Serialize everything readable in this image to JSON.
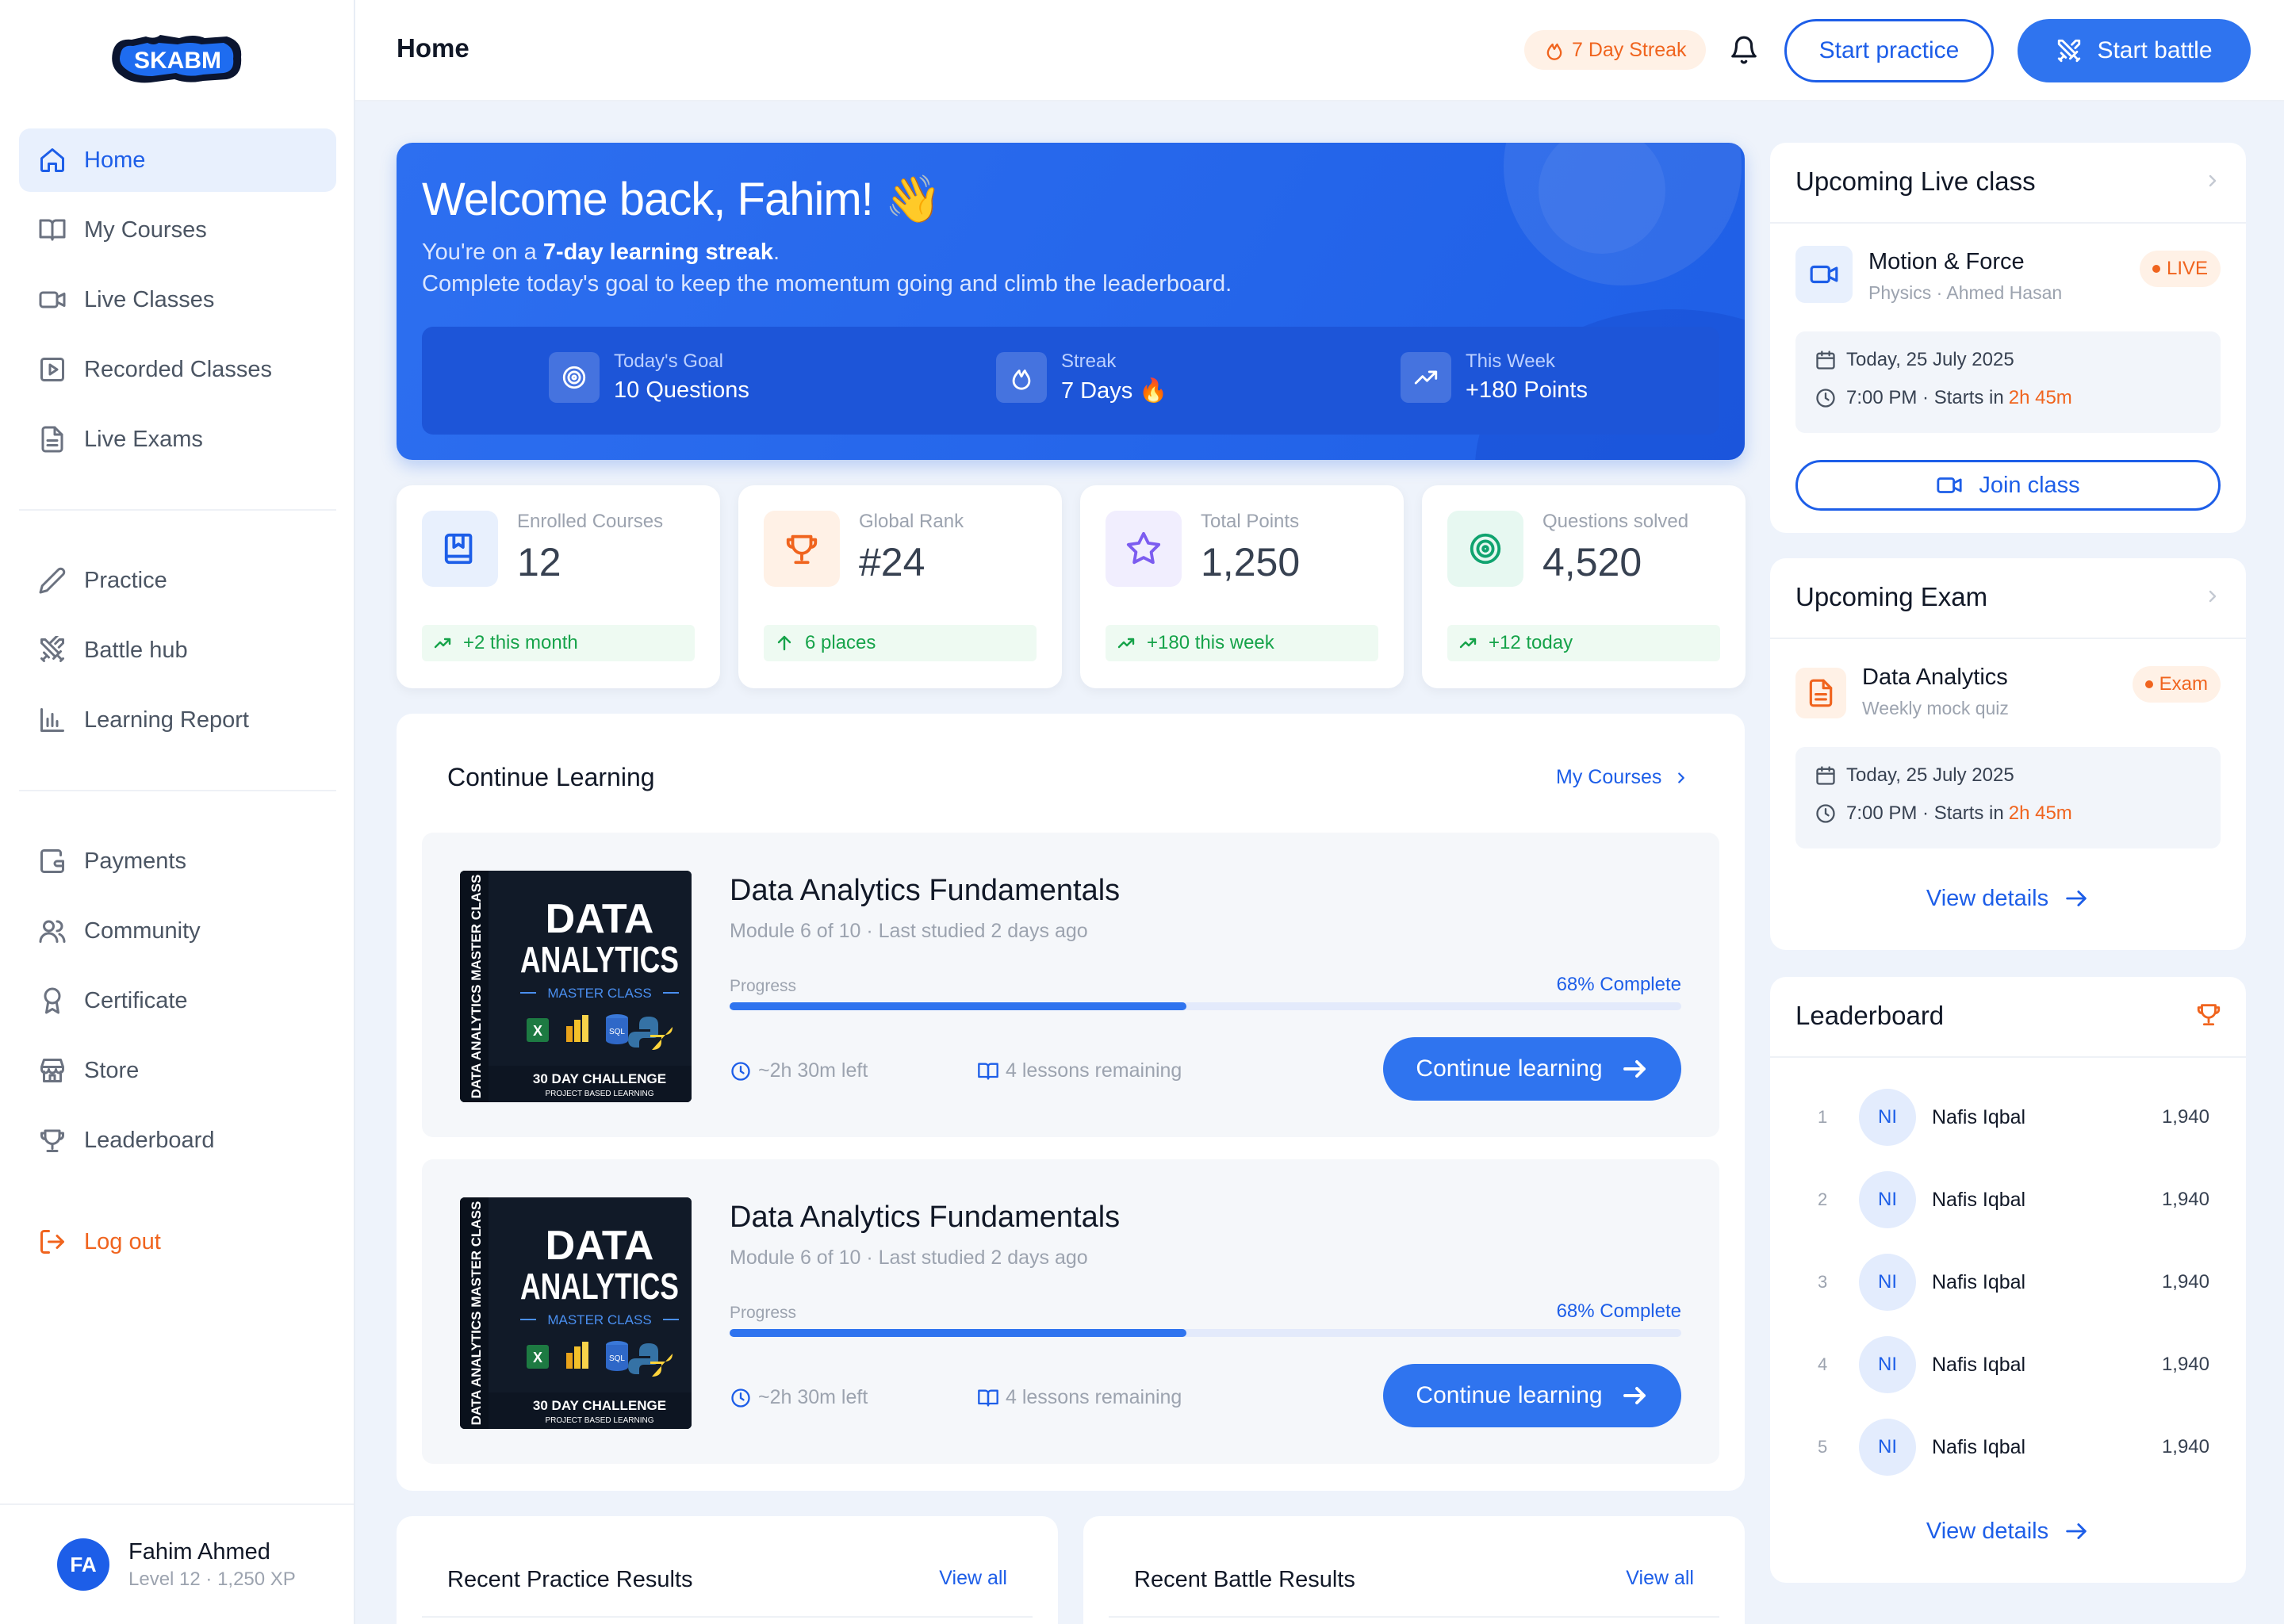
{
  "app": {
    "logo_text": "SKABM"
  },
  "sidebar": {
    "items": [
      {
        "label": "Home",
        "icon": "home-icon"
      },
      {
        "label": "My Courses",
        "icon": "book-open-icon"
      },
      {
        "label": "Live Classes",
        "icon": "video-icon"
      },
      {
        "label": "Recorded Classes",
        "icon": "play-square-icon"
      },
      {
        "label": "Live Exams",
        "icon": "document-icon"
      },
      {
        "label": "Practice",
        "icon": "pen-icon"
      },
      {
        "label": "Battle hub",
        "icon": "swords-icon"
      },
      {
        "label": "Learning Report",
        "icon": "bar-chart-icon"
      },
      {
        "label": "Payments",
        "icon": "wallet-icon"
      },
      {
        "label": "Community",
        "icon": "users-icon"
      },
      {
        "label": "Certificate",
        "icon": "award-icon"
      },
      {
        "label": "Store",
        "icon": "store-icon"
      },
      {
        "label": "Leaderboard",
        "icon": "trophy-icon"
      }
    ],
    "logout": "Log out",
    "user": {
      "initials": "FA",
      "name": "Fahim Ahmed",
      "sub": "Level 12 · 1,250 XP"
    }
  },
  "header": {
    "title": "Home",
    "streak": "7 Day Streak",
    "start_practice": "Start practice",
    "start_battle": "Start battle"
  },
  "welcome": {
    "title": "Welcome back, Fahim! 👋",
    "line1_pre": "You're on a ",
    "line1_bold": "7-day learning streak",
    "line1_post": ".",
    "line2": "Complete today's goal to keep the momentum going and climb the leaderboard.",
    "stats": [
      {
        "label": "Today's Goal",
        "value": "10 Questions"
      },
      {
        "label": "Streak",
        "value": "7 Days 🔥"
      },
      {
        "label": "This Week",
        "value": "+180 Points"
      }
    ]
  },
  "stats": [
    {
      "label": "Enrolled Courses",
      "value": "12",
      "foot": "+2 this month",
      "foot_icon": "trend-up-icon"
    },
    {
      "label": "Global Rank",
      "value": "#24",
      "foot": "6 places",
      "foot_icon": "arrow-up-icon"
    },
    {
      "label": "Total Points",
      "value": "1,250",
      "foot": "+180 this week",
      "foot_icon": "trend-up-icon"
    },
    {
      "label": "Questions solved",
      "value": "4,520",
      "foot": "+12 today",
      "foot_icon": "trend-up-icon"
    }
  ],
  "continue_learning": {
    "title": "Continue Learning",
    "link": "My Courses",
    "courses": [
      {
        "name": "Data Analytics Fundamentals",
        "meta": "Module 6 of 10 · Last studied 2 days ago",
        "progress_label": "Progress",
        "progress_text": "68% Complete",
        "progress": 0.48,
        "time_left": "~2h 30m left",
        "lessons": "4 lessons remaining",
        "button": "Continue learning",
        "thumb": {
          "side": "DATA ANALYTICS MASTER CLASS",
          "t1": "DATA",
          "t2": "ANALYTICS",
          "t3": "MASTER CLASS",
          "t4": "30 DAY CHALLENGE",
          "t5": "PROJECT BASED LEARNING"
        }
      },
      {
        "name": "Data Analytics Fundamentals",
        "meta": "Module 6 of 10 · Last studied 2 days ago",
        "progress_label": "Progress",
        "progress_text": "68% Complete",
        "progress": 0.48,
        "time_left": "~2h 30m left",
        "lessons": "4 lessons remaining",
        "button": "Continue learning",
        "thumb": {
          "side": "DATA ANALYTICS MASTER CLASS",
          "t1": "DATA",
          "t2": "ANALYTICS",
          "t3": "MASTER CLASS",
          "t4": "30 DAY CHALLENGE",
          "t5": "PROJECT BASED LEARNING"
        }
      }
    ]
  },
  "practice_results": {
    "title": "Recent Practice Results",
    "link": "View all"
  },
  "battle_results": {
    "title": "Recent Battle Results",
    "link": "View all"
  },
  "live_class": {
    "title": "Upcoming Live class",
    "name": "Motion & Force",
    "sub": "Physics · Ahmed Hasan",
    "tag": "LIVE",
    "date": "Today, 25 July 2025",
    "time_pre": "7:00 PM · Starts in",
    "time_left": "2h 45m",
    "button": "Join class"
  },
  "exam": {
    "title": "Upcoming Exam",
    "name": "Data Analytics",
    "sub": "Weekly mock quiz",
    "tag": "Exam",
    "date": "Today, 25 July 2025",
    "time_pre": "7:00 PM · Starts in",
    "time_left": "2h 45m",
    "link": "View details"
  },
  "leaderboard": {
    "title": "Leaderboard",
    "rows": [
      {
        "rank": "1",
        "initials": "NI",
        "name": "Nafis Iqbal",
        "points": "1,940"
      },
      {
        "rank": "2",
        "initials": "NI",
        "name": "Nafis Iqbal",
        "points": "1,940"
      },
      {
        "rank": "3",
        "initials": "NI",
        "name": "Nafis Iqbal",
        "points": "1,940"
      },
      {
        "rank": "4",
        "initials": "NI",
        "name": "Nafis Iqbal",
        "points": "1,940"
      },
      {
        "rank": "5",
        "initials": "NI",
        "name": "Nafis Iqbal",
        "points": "1,940"
      }
    ],
    "link": "View details"
  },
  "colors": {
    "primary": "#1d5ee8",
    "accent_orange": "#f0641e",
    "success": "#16a34a"
  }
}
